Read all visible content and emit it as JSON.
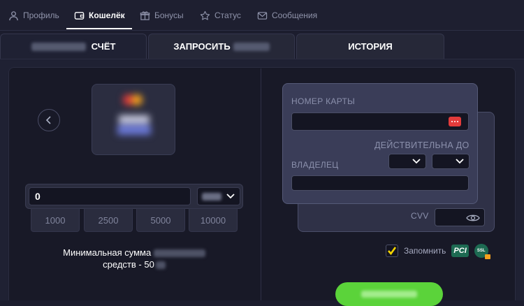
{
  "nav": {
    "items": [
      {
        "label": "Профиль",
        "icon": "user-icon"
      },
      {
        "label": "Кошелёк",
        "icon": "wallet-icon",
        "active": true
      },
      {
        "label": "Бонусы",
        "icon": "gift-icon"
      },
      {
        "label": "Статус",
        "icon": "star-icon"
      },
      {
        "label": "Сообщения",
        "icon": "mail-icon"
      }
    ]
  },
  "tabs": {
    "deposit": "СЧЁТ",
    "withdraw": "ЗАПРОСИТЬ",
    "history": "ИСТОРИЯ"
  },
  "amount": {
    "value": "0",
    "presets": [
      "1000",
      "2500",
      "5000",
      "10000"
    ],
    "min_line1": "Минимальная сумма",
    "min_line2": "средств - 50"
  },
  "card_form": {
    "number_label": "НОМЕР КАРТЫ",
    "valid_label": "ДЕЙСТВИТЕЛЬНА ДО",
    "holder_label": "ВЛАДЕЛЕЦ",
    "cvv_label": "CVV",
    "remember_label": "Запомнить",
    "remember_checked": true
  },
  "badges": {
    "pci": "PCI",
    "ssl": "SSL"
  },
  "colors": {
    "accent_green": "#5bd33a",
    "check_yellow": "#f5d500",
    "card_icon_red": "#e23b3b"
  }
}
